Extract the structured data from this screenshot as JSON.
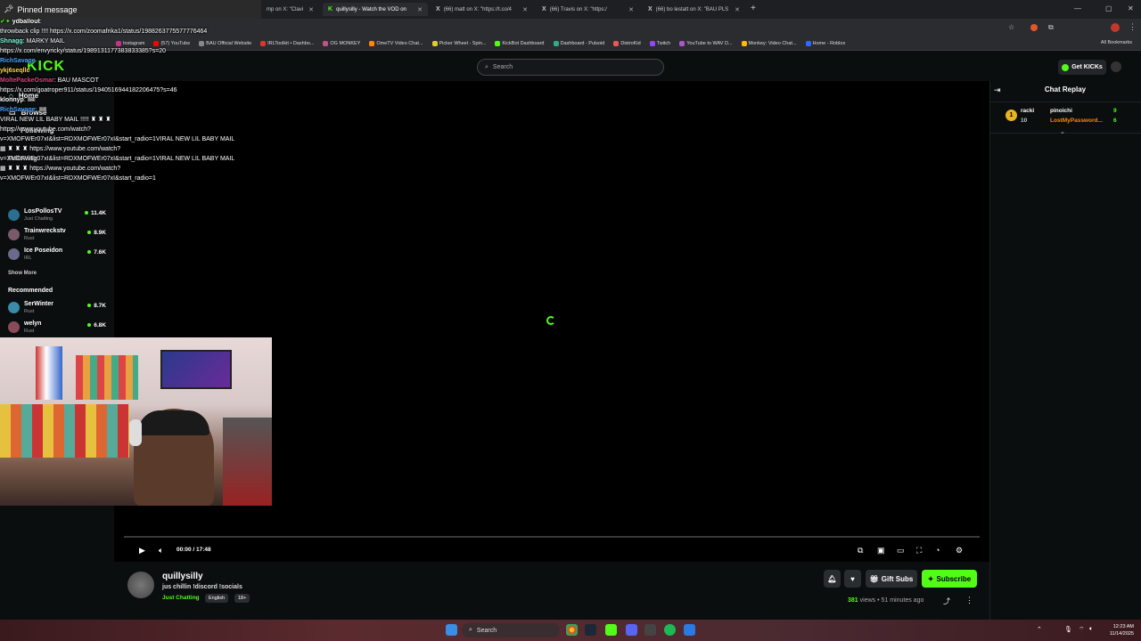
{
  "browser": {
    "tabs": [
      {
        "label": "mp on X: \"Clavi",
        "active": false
      },
      {
        "label": "quillysilly - Watch the VOD on",
        "active": true
      },
      {
        "label": "(66) matt on X: \"https://t.co/4",
        "active": false
      },
      {
        "label": "(66) Travis on X: \"https:/",
        "active": false
      },
      {
        "label": "(66) bo lestatt on X: \"BAU PLS",
        "active": false
      }
    ],
    "bookmarks": [
      "Instagram",
      "(57) YouTube",
      "BAU Official Website",
      "IRLToolkit • Dashbo...",
      "OG MONKEY",
      "OmeTV Video Chat...",
      "Picker Wheel - Spin...",
      "KickBot Dashboard",
      "Dashboard - Pulsoid",
      "DistroKid",
      "Twitch",
      "YouTube to WAV D...",
      "Monkey: Video Chat...",
      "Home - Roblox"
    ],
    "all_bookmarks": "All Bookmarks"
  },
  "kick": {
    "logo": "KICK",
    "search_placeholder": "Search",
    "get_kicks": "Get KICKs"
  },
  "overlay": {
    "pinned_title": "Pinned message",
    "lines": [
      {
        "user": "ydballout",
        "text": ""
      },
      {
        "user": "",
        "text": "throwback clip !!!! https://x.com/zoomafrika1/status/1988263775577776464"
      },
      {
        "user": "Shnagg",
        "text": "MARKY MAIL"
      },
      {
        "user": "",
        "text": "https://x.com/envyricky/status/1989131177383833385?s=20"
      },
      {
        "user": "RichSavage",
        "text": ""
      },
      {
        "user": "ykj6seqllc",
        "text": ""
      },
      {
        "user": "MoltePackeOsmar",
        "text": "BAU MASCOT"
      },
      {
        "user": "",
        "text": "https://x.com/goatroper911/status/1940516944182206475?s=46"
      },
      {
        "user": "klonnyp",
        "text": ""
      },
      {
        "user": "RichSavage",
        "text": ""
      },
      {
        "user": "",
        "text": "VIRAL NEW LIL BABY MAIL !!!!!"
      },
      {
        "user": "",
        "text": "https://www.youtube.com/watch?"
      },
      {
        "user": "",
        "text": "v=XMOFWEr07xI&list=RDXMOFWEr07xI&start_radio=1VIRAL NEW LIL BABY MAIL"
      },
      {
        "user": "",
        "text": "https://www.youtube.com/watch?"
      },
      {
        "user": "",
        "text": "v=XMOFWEr07xI&list=RDXMOFWEr07xI&start_radio=1VIRAL NEW LIL BABY MAIL"
      },
      {
        "user": "",
        "text": "https://www.youtube.com/watch?"
      },
      {
        "user": "",
        "text": "v=XMOFWEr07xI&list=RDXMOFWEr07xI&start_radio=1"
      }
    ]
  },
  "sidebar": {
    "nav": [
      {
        "label": "Home",
        "icon": "home-icon"
      },
      {
        "label": "Browse",
        "icon": "browse-icon"
      },
      {
        "label": "Following",
        "icon": "heart-icon"
      }
    ],
    "following_title": "Following",
    "channels": [
      {
        "name": "LosPollosTV",
        "category": "Just Chatting",
        "viewers": "11.4K"
      },
      {
        "name": "Trainwreckstv",
        "category": "Rust",
        "viewers": "8.9K"
      },
      {
        "name": "Ice Poseidon",
        "category": "IRL",
        "viewers": "7.6K"
      }
    ],
    "show_more": "Show More",
    "recommended_title": "Recommended",
    "recommended": [
      {
        "name": "SerWinter",
        "category": "Rust",
        "viewers": "8.7K"
      },
      {
        "name": "welyn",
        "category": "Rust",
        "viewers": "6.8K"
      }
    ]
  },
  "player": {
    "time": "00:00 / 17:48",
    "progress": 0
  },
  "channel": {
    "name": "quillysilly",
    "title": "jus chillin !discord !socials",
    "category": "Just Chatting",
    "tags": [
      "English",
      "18+"
    ],
    "gift_subs": "Gift Subs",
    "subscribe": "Subscribe",
    "views_count": "381",
    "views_label": "views",
    "ago": "51 minutes ago"
  },
  "chat": {
    "title": "Chat Replay",
    "leaderboard": {
      "rank": "1",
      "left_user": "racki",
      "left_score": "10",
      "right_top_user": "pinoichi",
      "right_top_score": "9",
      "right_bottom_user": "LostMyPassword...",
      "right_bottom_score": "6"
    }
  },
  "taskbar": {
    "search": "Search",
    "time": "12:23 AM",
    "date": "11/14/2025"
  },
  "colors": {
    "accent": "#53fc18"
  }
}
